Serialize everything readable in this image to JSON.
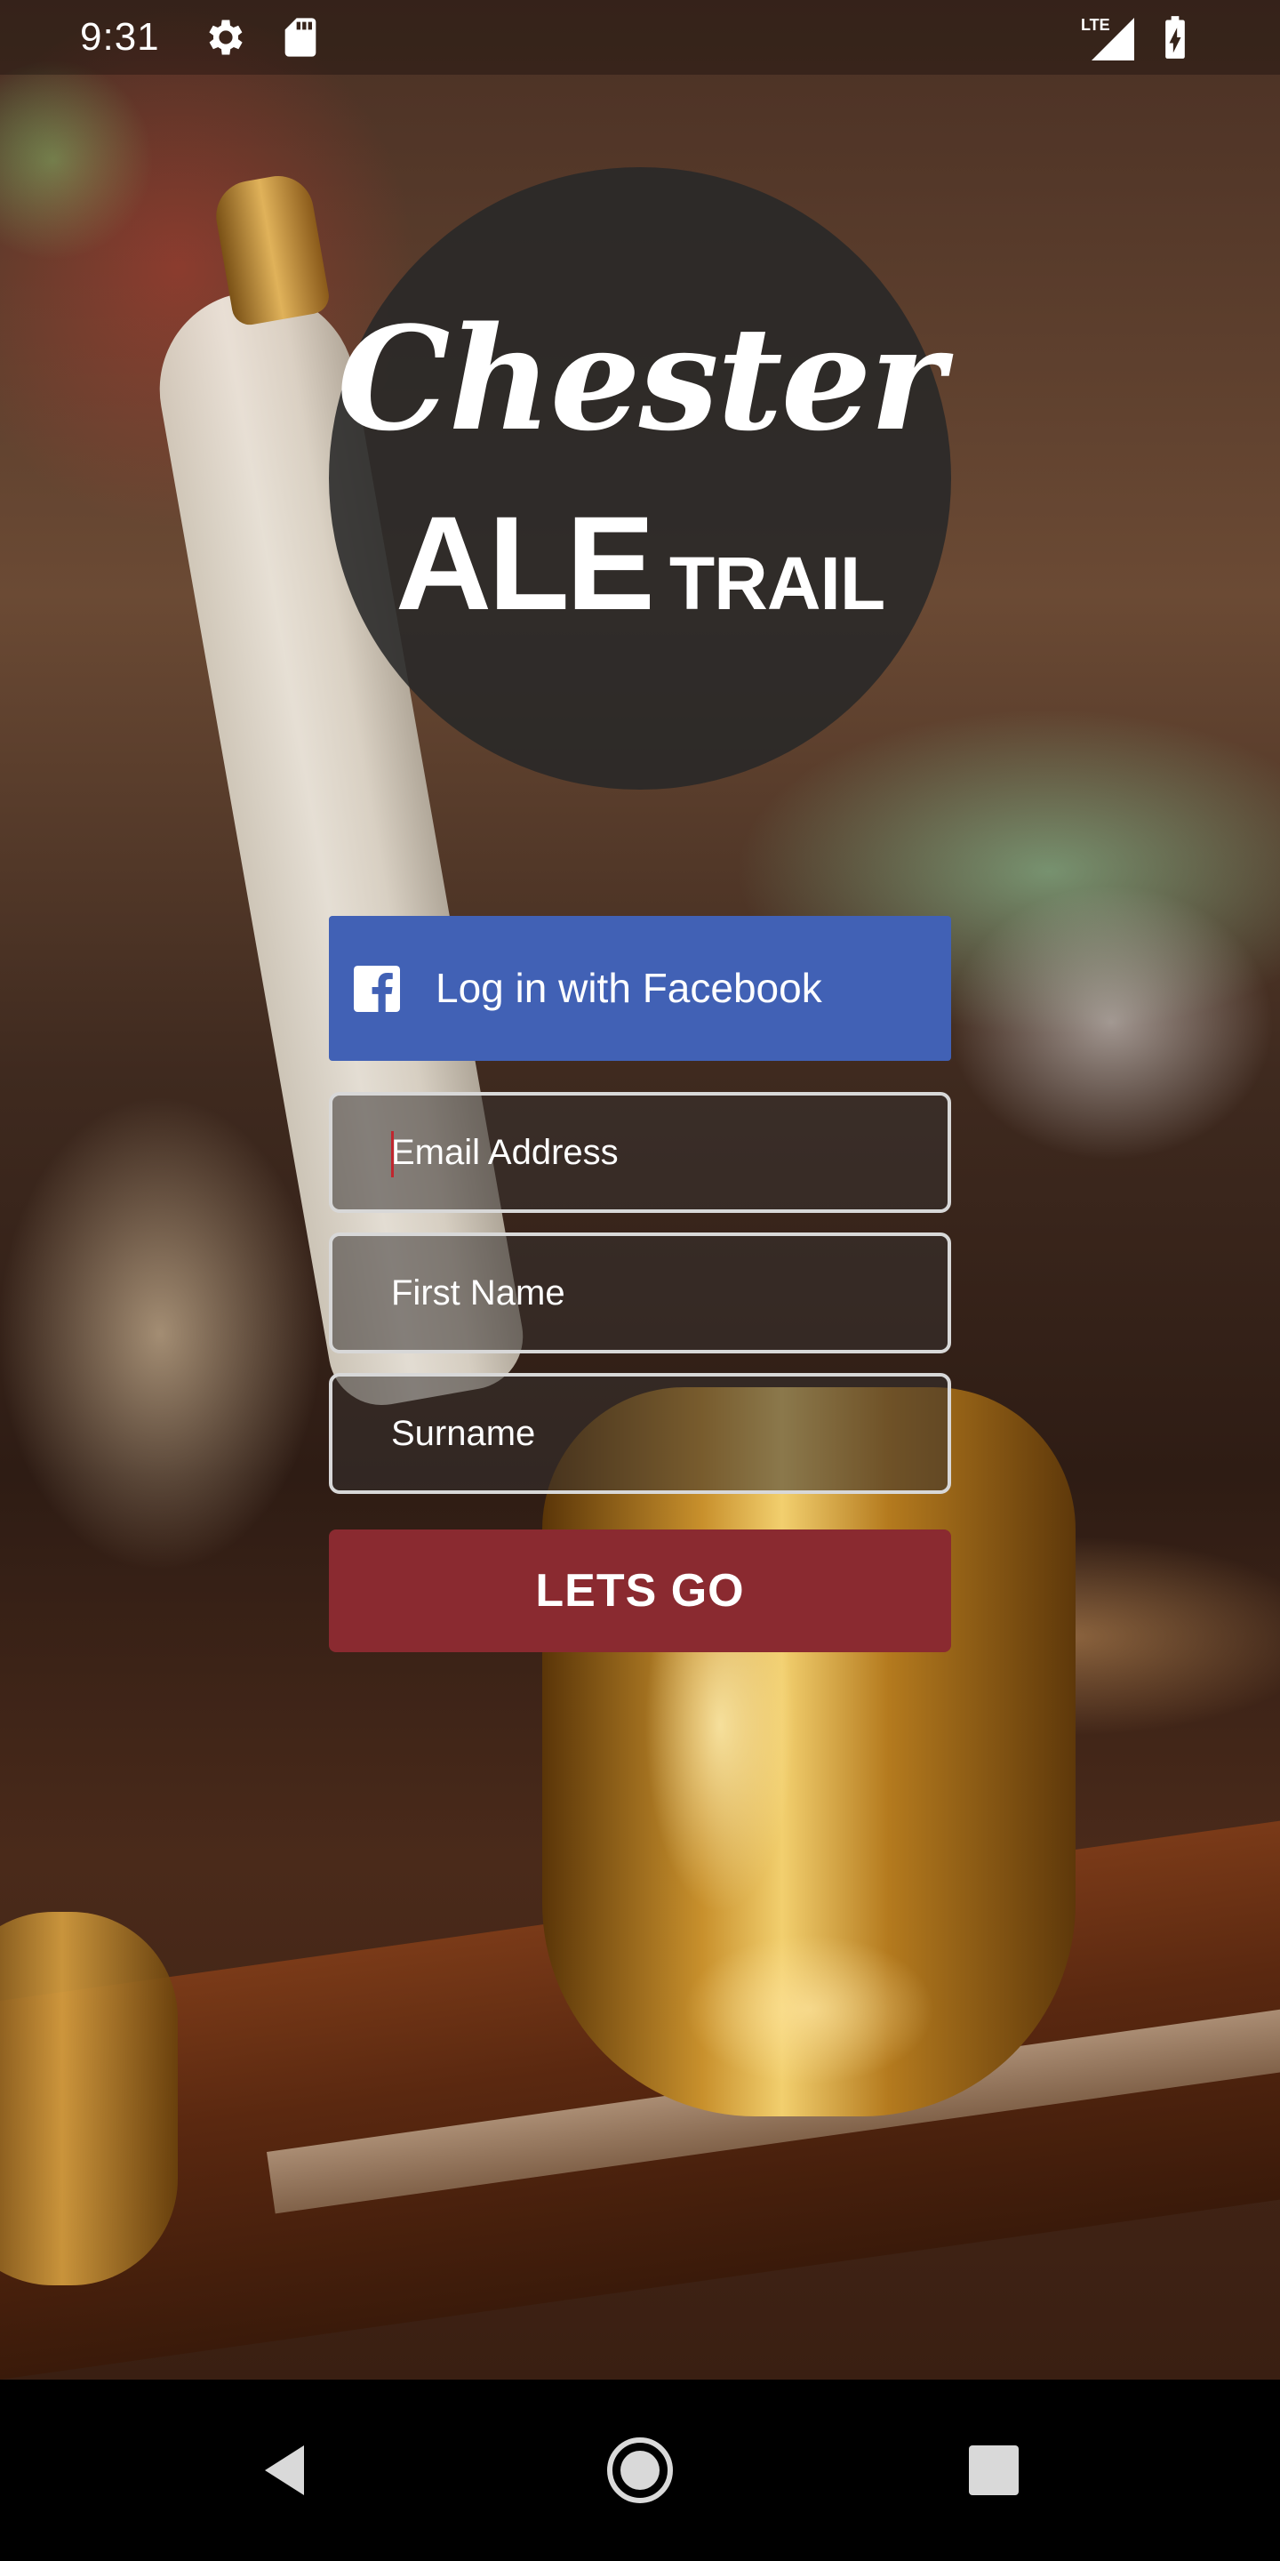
{
  "status_bar": {
    "time": "9:31",
    "icons": [
      "gear-icon",
      "sd-card-icon",
      "lte-signal-icon",
      "battery-charging-icon"
    ],
    "network_label": "LTE"
  },
  "logo": {
    "line1": "Chester",
    "line2a": "ALE",
    "line2b": "TRAIL"
  },
  "facebook_button": {
    "label": "Log in with Facebook",
    "icon": "facebook-icon",
    "color": "#4161b5"
  },
  "form": {
    "email": {
      "placeholder": "Email Address",
      "value": ""
    },
    "first_name": {
      "placeholder": "First Name",
      "value": ""
    },
    "surname": {
      "placeholder": "Surname",
      "value": ""
    }
  },
  "submit_button": {
    "label": "LETS GO",
    "color": "#8a2a30"
  },
  "nav_bar": {
    "icons": [
      "back-icon",
      "home-icon",
      "recents-icon"
    ]
  }
}
